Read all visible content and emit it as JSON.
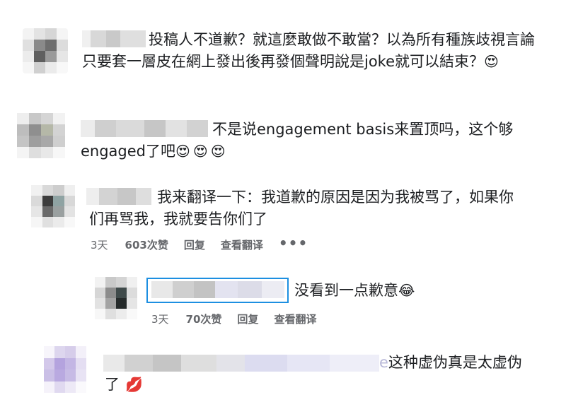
{
  "comments": [
    {
      "text": "投稿人不道歉？就這麼敢做不敢當？以為所有種族歧視言論只要套一層皮在網上發出後再發個聲明說是joke就可以結束？",
      "emoji": [
        "heart-eyes"
      ]
    },
    {
      "text": "不是说engagement basis来置顶吗，这个够engaged了吧",
      "emoji": [
        "heart-eyes",
        "heart-eyes",
        "heart-eyes"
      ]
    },
    {
      "text": "我来翻译一下：我道歉的原因是因为我被骂了，如果你们再骂我，我就要告你们了",
      "meta": {
        "time": "3天",
        "likes": "603次赞",
        "reply": "回复",
        "translate": "查看翻译",
        "more": "•••"
      }
    },
    {
      "text": "没看到一点歉意",
      "emoji": [
        "tears-of-joy"
      ],
      "meta": {
        "time": "3天",
        "likes": "70次赞",
        "reply": "回复",
        "translate": "查看翻译"
      }
    },
    {
      "text_tail": "e",
      "text": "这种虚伪真是太虚伪了",
      "emoji": [
        "kiss-lips"
      ]
    }
  ]
}
